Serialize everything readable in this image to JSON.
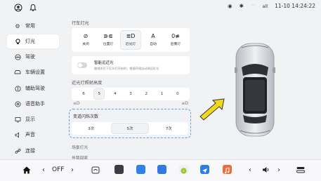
{
  "status": {
    "time": "11-10 14:24:22",
    "signal_text": "all"
  },
  "sidebar": {
    "items": [
      {
        "label": "常用",
        "icon": "gear-icon",
        "active": false
      },
      {
        "label": "灯光",
        "icon": "bulb-icon",
        "active": true
      },
      {
        "label": "驾驶",
        "icon": "steering-wheel-icon",
        "active": false
      },
      {
        "label": "车辆设置",
        "icon": "car-icon",
        "active": false
      },
      {
        "label": "辅助驾驶",
        "icon": "assist-icon",
        "active": false
      },
      {
        "label": "语音助手",
        "icon": "voice-icon",
        "active": false
      },
      {
        "label": "显示",
        "icon": "display-icon",
        "active": false
      },
      {
        "label": "声音",
        "icon": "speaker-icon",
        "active": false
      },
      {
        "label": "连接",
        "icon": "link-icon",
        "active": false
      }
    ]
  },
  "content": {
    "driving_light_title": "行车灯光",
    "light_options": [
      {
        "label": "关闭",
        "icon": "light-off-icon",
        "selected": false
      },
      {
        "label": "位置灯",
        "icon": "position-light-icon",
        "selected": false
      },
      {
        "label": "近光灯",
        "icon": "low-beam-icon",
        "selected": true
      },
      {
        "label": "自动",
        "icon": "auto-icon",
        "selected": false
      },
      {
        "label": "后雾灯",
        "icon": "rear-fog-icon",
        "selected": false
      }
    ],
    "smart_high_beam": {
      "title": "智能远近光",
      "desc": "路域夫灯下近光灯开启时，根据环境自动调远近光",
      "enabled": false
    },
    "beam_height_title": "近光灯照射高度",
    "beam_heights": [
      "6",
      "5",
      "4",
      "3",
      "2",
      "1",
      "0"
    ],
    "beam_height_selected": "5",
    "flash_title": "变道闪烁次数",
    "flash_options": [
      {
        "label": "3次",
        "selected": false
      },
      {
        "label": "5次",
        "selected": true
      },
      {
        "label": "7次",
        "selected": false
      }
    ],
    "scene_light_title": "场景灯光",
    "follow_home_title": "伴我回家"
  },
  "dock": {
    "off_label": "OFF"
  },
  "colors": {
    "accent": "#3b7de0",
    "arrow_yellow": "#f2d81c",
    "dashed_border": "#6a9fe0"
  }
}
